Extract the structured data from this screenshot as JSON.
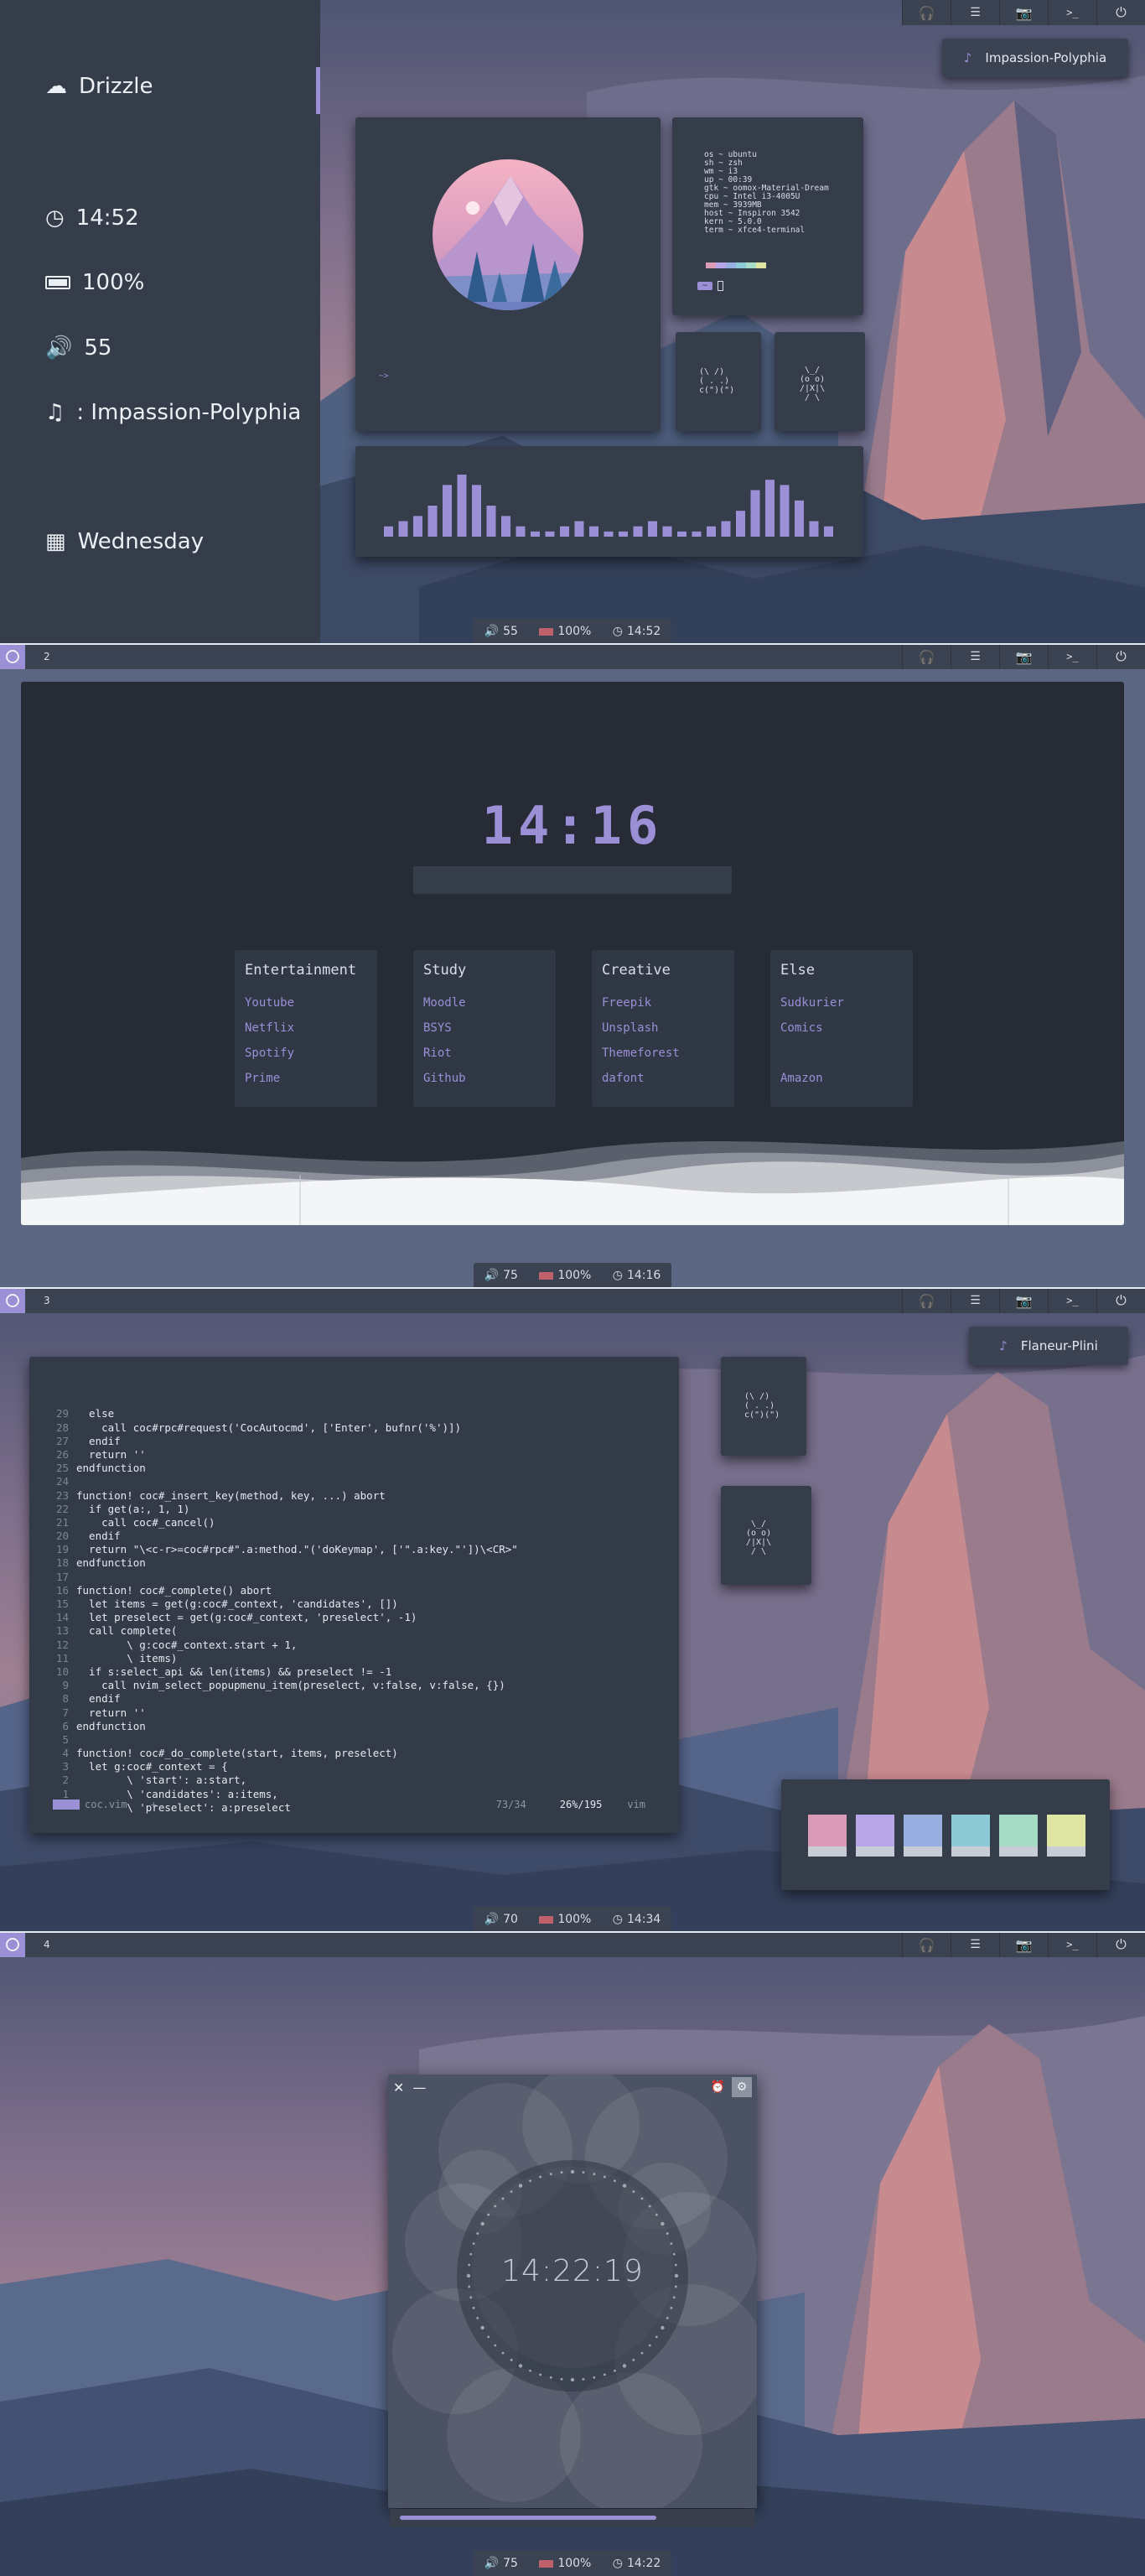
{
  "workspace_numbers": [
    "2",
    "3",
    "4"
  ],
  "colors": {
    "accent": "#9b8fd6",
    "bar": "#3b4252",
    "panel": "#353c4a",
    "dark": "#272b36"
  },
  "tray_icons": [
    "headphones-icon",
    "list-icon",
    "camera-icon",
    "terminal-icon",
    "power-icon"
  ],
  "screen1": {
    "music_badge": "Impassion-Polyphia",
    "sidebar": {
      "weather": "Drizzle",
      "time": "14:52",
      "battery": "100%",
      "volume": "55",
      "song": ": Impassion-Polyphia",
      "day": "Wednesday"
    },
    "neofetch": [
      "os ~ ubuntu",
      "sh ~ zsh",
      "wm ~ i3",
      "up ~ 00:39",
      "gtk ~ oomox-Material-Dream",
      "cpu ~ Intel i3-4005U",
      "mem ~ 3939MB",
      "host ~ Inspiron 3542",
      "kern ~ 5.0.0",
      "term ~ xfce4-terminal"
    ],
    "prompt_left": "~",
    "art_prompt": "~>",
    "kaomoji": [
      "(\\ /)",
      "( . .)",
      "c(\")(\")"
    ],
    "spider": [
      " .-. ",
      "(o.o)",
      "/|\\ ",
      "/ \\"
    ],
    "bars": [
      2,
      3,
      4,
      6,
      10,
      12,
      10,
      6,
      4,
      2,
      1,
      1,
      2,
      3,
      2,
      1,
      1,
      2,
      3,
      2,
      1,
      1,
      2,
      3,
      5,
      9,
      11,
      10,
      7,
      3,
      2
    ],
    "bottom": {
      "volume": "55",
      "battery": "100%",
      "time": "14:52"
    }
  },
  "screen2": {
    "clock": "14:16",
    "categories": [
      {
        "title": "Entertainment",
        "links": [
          "Youtube",
          "Netflix",
          "Spotify",
          "Prime"
        ]
      },
      {
        "title": "Study",
        "links": [
          "Moodle",
          "BSYS",
          "Riot",
          "Github"
        ]
      },
      {
        "title": "Creative",
        "links": [
          "Freepik",
          "Unsplash",
          "Themeforest",
          "dafont"
        ]
      },
      {
        "title": "Else",
        "links": [
          "Sudkurier",
          "Comics",
          "",
          "Amazon"
        ]
      }
    ],
    "bottom": {
      "volume": "75",
      "battery": "100%",
      "time": "14:16"
    }
  },
  "screen3": {
    "music_badge": "Flaneur-Plini",
    "code": [
      {
        "n": "29",
        "t": "  else"
      },
      {
        "n": "28",
        "t": "    call coc#rpc#request('CocAutocmd', ['Enter', bufnr('%')])"
      },
      {
        "n": "27",
        "t": "  endif"
      },
      {
        "n": "26",
        "t": "  return ''"
      },
      {
        "n": "25",
        "t": "endfunction"
      },
      {
        "n": "24",
        "t": ""
      },
      {
        "n": "23",
        "t": "function! coc#_insert_key(method, key, ...) abort"
      },
      {
        "n": "22",
        "t": "  if get(a:, 1, 1)"
      },
      {
        "n": "21",
        "t": "    call coc#_cancel()"
      },
      {
        "n": "20",
        "t": "  endif"
      },
      {
        "n": "19",
        "t": "  return \"\\<c-r>=coc#rpc#\".a:method.\"('doKeymap', ['\".a:key.\"'])\\<CR>\""
      },
      {
        "n": "18",
        "t": "endfunction"
      },
      {
        "n": "17",
        "t": ""
      },
      {
        "n": "16",
        "t": "function! coc#_complete() abort"
      },
      {
        "n": "15",
        "t": "  let items = get(g:coc#_context, 'candidates', [])"
      },
      {
        "n": "14",
        "t": "  let preselect = get(g:coc#_context, 'preselect', -1)"
      },
      {
        "n": "13",
        "t": "  call complete("
      },
      {
        "n": "12",
        "t": "        \\ g:coc#_context.start + 1,"
      },
      {
        "n": "11",
        "t": "        \\ items)"
      },
      {
        "n": "10",
        "t": "  if s:select_api && len(items) && preselect != -1"
      },
      {
        "n": "9",
        "t": "    call nvim_select_popupmenu_item(preselect, v:false, v:false, {})"
      },
      {
        "n": "8",
        "t": "  endif"
      },
      {
        "n": "7",
        "t": "  return ''"
      },
      {
        "n": "6",
        "t": "endfunction"
      },
      {
        "n": "5",
        "t": ""
      },
      {
        "n": "4",
        "t": "function! coc#_do_complete(start, items, preselect)"
      },
      {
        "n": "3",
        "t": "  let g:coc#_context = {"
      },
      {
        "n": "2",
        "t": "        \\ 'start': a:start,"
      },
      {
        "n": "1",
        "t": "        \\ 'candidates': a:items,"
      },
      {
        "n": "",
        "t": "        \\ 'preselect': a:preselect"
      }
    ],
    "status_file": "coc.vim",
    "status_mode": "+",
    "status_pos": "73/34",
    "status_pct": "26%/195",
    "status_ft": "vim",
    "palette": [
      "#d99bb6",
      "#b7a6e8",
      "#96aee0",
      "#8ccbd6",
      "#a6dcc5",
      "#dfe6a4"
    ],
    "bottom": {
      "volume": "70",
      "battery": "100%",
      "time": "14:34"
    }
  },
  "screen4": {
    "clock": "14:22:19",
    "progress": 0.72,
    "bottom": {
      "volume": "75",
      "battery": "100%",
      "time": "14:22"
    }
  }
}
